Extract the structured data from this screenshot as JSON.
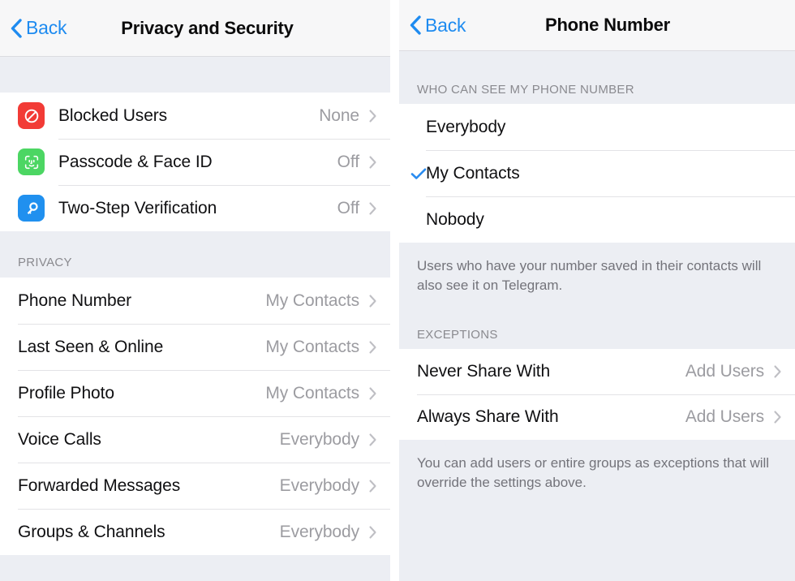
{
  "left_screen": {
    "nav": {
      "back_label": "Back",
      "back_icon": "chevron-left-icon",
      "title": "Privacy and Security"
    },
    "security_section": {
      "rows": [
        {
          "label": "Blocked Users",
          "value": "None",
          "icon": "blocked-user-icon",
          "icon_color": "#f23b36"
        },
        {
          "label": "Passcode & Face ID",
          "value": "Off",
          "icon": "face-id-icon",
          "icon_color": "#4cd663"
        },
        {
          "label": "Two-Step Verification",
          "value": "Off",
          "icon": "key-icon",
          "icon_color": "#2090ef"
        }
      ]
    },
    "privacy_section": {
      "header": "PRIVACY",
      "rows": [
        {
          "label": "Phone Number",
          "value": "My Contacts"
        },
        {
          "label": "Last Seen & Online",
          "value": "My Contacts"
        },
        {
          "label": "Profile Photo",
          "value": "My Contacts"
        },
        {
          "label": "Voice Calls",
          "value": "Everybody"
        },
        {
          "label": "Forwarded Messages",
          "value": "Everybody"
        },
        {
          "label": "Groups & Channels",
          "value": "Everybody"
        }
      ]
    }
  },
  "right_screen": {
    "nav": {
      "back_label": "Back",
      "back_icon": "chevron-left-icon",
      "title": "Phone Number"
    },
    "visibility_section": {
      "header": "WHO CAN SEE MY PHONE NUMBER",
      "options": [
        {
          "label": "Everybody",
          "selected": false
        },
        {
          "label": "My Contacts",
          "selected": true
        },
        {
          "label": "Nobody",
          "selected": false
        }
      ],
      "footer": "Users who have your number saved in their contacts will also see it on Telegram."
    },
    "exceptions_section": {
      "header": "EXCEPTIONS",
      "rows": [
        {
          "label": "Never Share With",
          "value": "Add Users"
        },
        {
          "label": "Always Share With",
          "value": "Add Users"
        }
      ],
      "footer": "You can add users or entire groups as exceptions that will override the settings above."
    }
  },
  "colors": {
    "accent_blue": "#1e8bf0",
    "check_blue": "#2a8cf0",
    "group_background": "#eceef3",
    "row_background": "#ffffff",
    "value_gray": "#9c9ca1",
    "header_gray": "#8a8a8f"
  }
}
